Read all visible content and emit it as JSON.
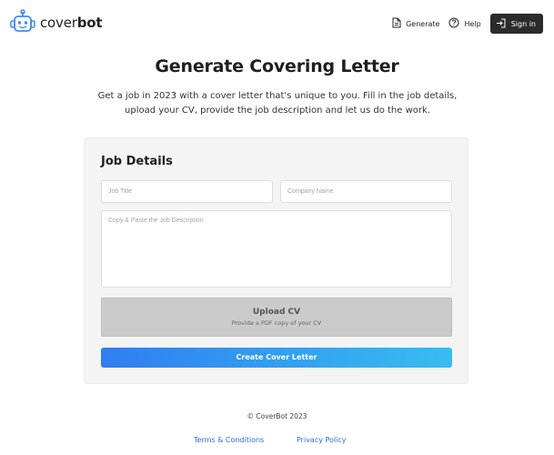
{
  "header": {
    "brand_prefix": "cover",
    "brand_suffix": "bot",
    "nav": {
      "generate_label": "Generate",
      "help_label": "Help",
      "signin_label": "Sign in"
    }
  },
  "hero": {
    "title": "Generate Covering Letter",
    "subtitle_line1": "Get a job in 2023 with a cover letter that's unique to you. Fill in the job details,",
    "subtitle_line2": "upload your CV, provide the job description and let us do the work."
  },
  "form": {
    "section_title": "Job Details",
    "job_title_placeholder": "Job Title",
    "company_placeholder": "Company Name",
    "description_placeholder": "Copy & Paste the Job Description",
    "upload_label": "Upload CV",
    "upload_hint": "Provide a PDF copy of your CV",
    "submit_label": "Create Cover Letter"
  },
  "footer": {
    "copyright": "© CoverBot 2023",
    "terms_label": "Terms & Conditions",
    "privacy_label": "Privacy Policy"
  },
  "colors": {
    "logo_accent": "#3a8ef0",
    "signin_bg": "#2b2b2b",
    "button_gradient_start": "#2f7ef0",
    "button_gradient_end": "#38bdf0",
    "link": "#2d6cdf"
  },
  "icons": {
    "logo": "robot-icon",
    "generate": "document-icon",
    "help": "help-circle-icon",
    "signin": "login-icon"
  }
}
